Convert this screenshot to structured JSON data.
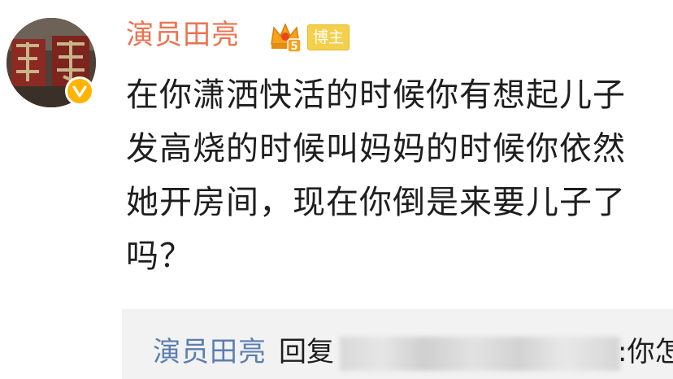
{
  "comment": {
    "username": "演员田亮",
    "level_badge": "5",
    "blogger_tag": "博主",
    "lines": [
      "在你潇洒快活的时候你有想起儿子",
      "发高烧的时候叫妈妈的时候你依然",
      "她开房间，现在你倒是来要儿子了",
      "吗？"
    ]
  },
  "reply": {
    "username": "演员田亮",
    "verb": "回复",
    "tail": ":你怎"
  },
  "colors": {
    "username": "#eb7350",
    "reply_username": "#5b7fb0",
    "verified": "#ffb400",
    "reply_background": "#f2f2f2"
  },
  "icons": {
    "avatar": "avatar-image",
    "verified": "verified-v-icon",
    "crown": "crown-icon"
  }
}
